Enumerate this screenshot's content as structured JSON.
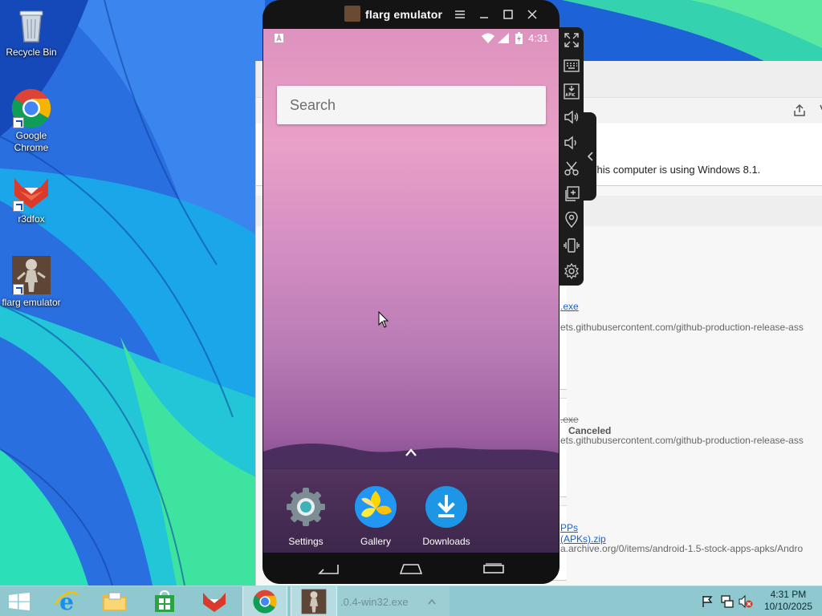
{
  "desktop": {
    "icons": [
      {
        "label": "Recycle Bin"
      },
      {
        "label": "Google Chrome"
      },
      {
        "label": "r3dfox"
      },
      {
        "label": "flarg emulator"
      }
    ]
  },
  "browser": {
    "notice": "r. This computer is using Windows 8.1.",
    "downloads": [
      {
        "file": ".exe",
        "url": "ets.githubusercontent.com/github-production-release-ass"
      },
      {
        "file": ".exe",
        "status": "Canceled",
        "url": "ets.githubusercontent.com/github-production-release-ass"
      },
      {
        "file": "PPs (APKs).zip",
        "url": "a.archive.org/0/items/android-1.5-stock-apps-apks/Andro"
      }
    ]
  },
  "emulator": {
    "title": "flarg emulator",
    "status_time": "4:31",
    "search_placeholder": "Search",
    "dock": [
      {
        "label": "Settings",
        "icon": "settings-gear-icon"
      },
      {
        "label": "Gallery",
        "icon": "gallery-icon"
      },
      {
        "label": "Downloads",
        "icon": "downloads-icon"
      }
    ],
    "sidebar_tools": [
      "fullscreen-icon",
      "keyboard-icon",
      "apk-install-icon",
      "volume-up-icon",
      "volume-down-icon",
      "screenshot-cut-icon",
      "multi-instance-icon",
      "location-icon",
      "shake-icon",
      "settings-icon"
    ]
  },
  "taskbar": {
    "task_text": ".0.4-win32.exe",
    "time": "4:31 PM",
    "date": "10/10/2025"
  },
  "colors": {
    "taskbar": "#8fc8cf",
    "emulator_frame": "#141414",
    "link": "#1a62c8"
  }
}
